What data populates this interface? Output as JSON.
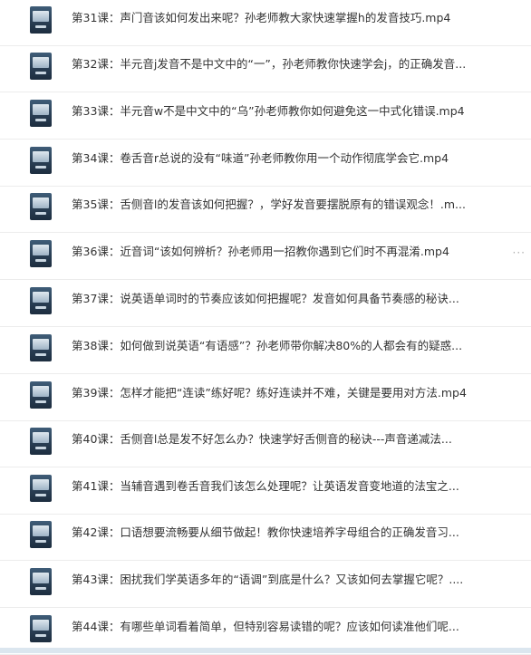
{
  "items": [
    {
      "title": "第31课：声门音该如何发出来呢？孙老师教大家快速掌握h的发音技巧.mp4"
    },
    {
      "title": "第32课：半元音j发音不是中文中的“一”，孙老师教你快速学会j，的正确发音..."
    },
    {
      "title": "第33课：半元音w不是中文中的“乌”孙老师教你如何避免这一中式化错误.mp4"
    },
    {
      "title": "第34课：卷舌音r总说的没有“味道”孙老师教你用一个动作彻底学会它.mp4"
    },
    {
      "title": "第35课：舌侧音l的发音该如何把握？，学好发音要摆脱原有的错误观念！.m..."
    },
    {
      "title": "第36课：近音词“该如何辨析？孙老师用一招教你遇到它们时不再混淆.mp4"
    },
    {
      "title": "第37课：说英语单词时的节奏应该如何把握呢？发音如何具备节奏感的秘诀..."
    },
    {
      "title": "第38课：如何做到说英语“有语感”？孙老师带你解决80%的人都会有的疑惑..."
    },
    {
      "title": "第39课：怎样才能把“连读”练好呢？练好连读并不难，关键是要用对方法.mp4"
    },
    {
      "title": "第40课：舌侧音l总是发不好怎么办？快速学好舌侧音的秘诀---声音递减法..."
    },
    {
      "title": "第41课：当辅音遇到卷舌音我们该怎么处理呢？让英语发音变地道的法宝之..."
    },
    {
      "title": "第42课：口语想要流畅要从细节做起！教你快速培养字母组合的正确发音习..."
    },
    {
      "title": "第43课：困扰我们学英语多年的“语调”到底是什么？又该如何去掌握它呢？...."
    },
    {
      "title": "第44课：有哪些单词看着简单，但特别容易读错的呢？应该如何读准他们呢..."
    }
  ],
  "more_label": "···",
  "more_row_index": 5
}
